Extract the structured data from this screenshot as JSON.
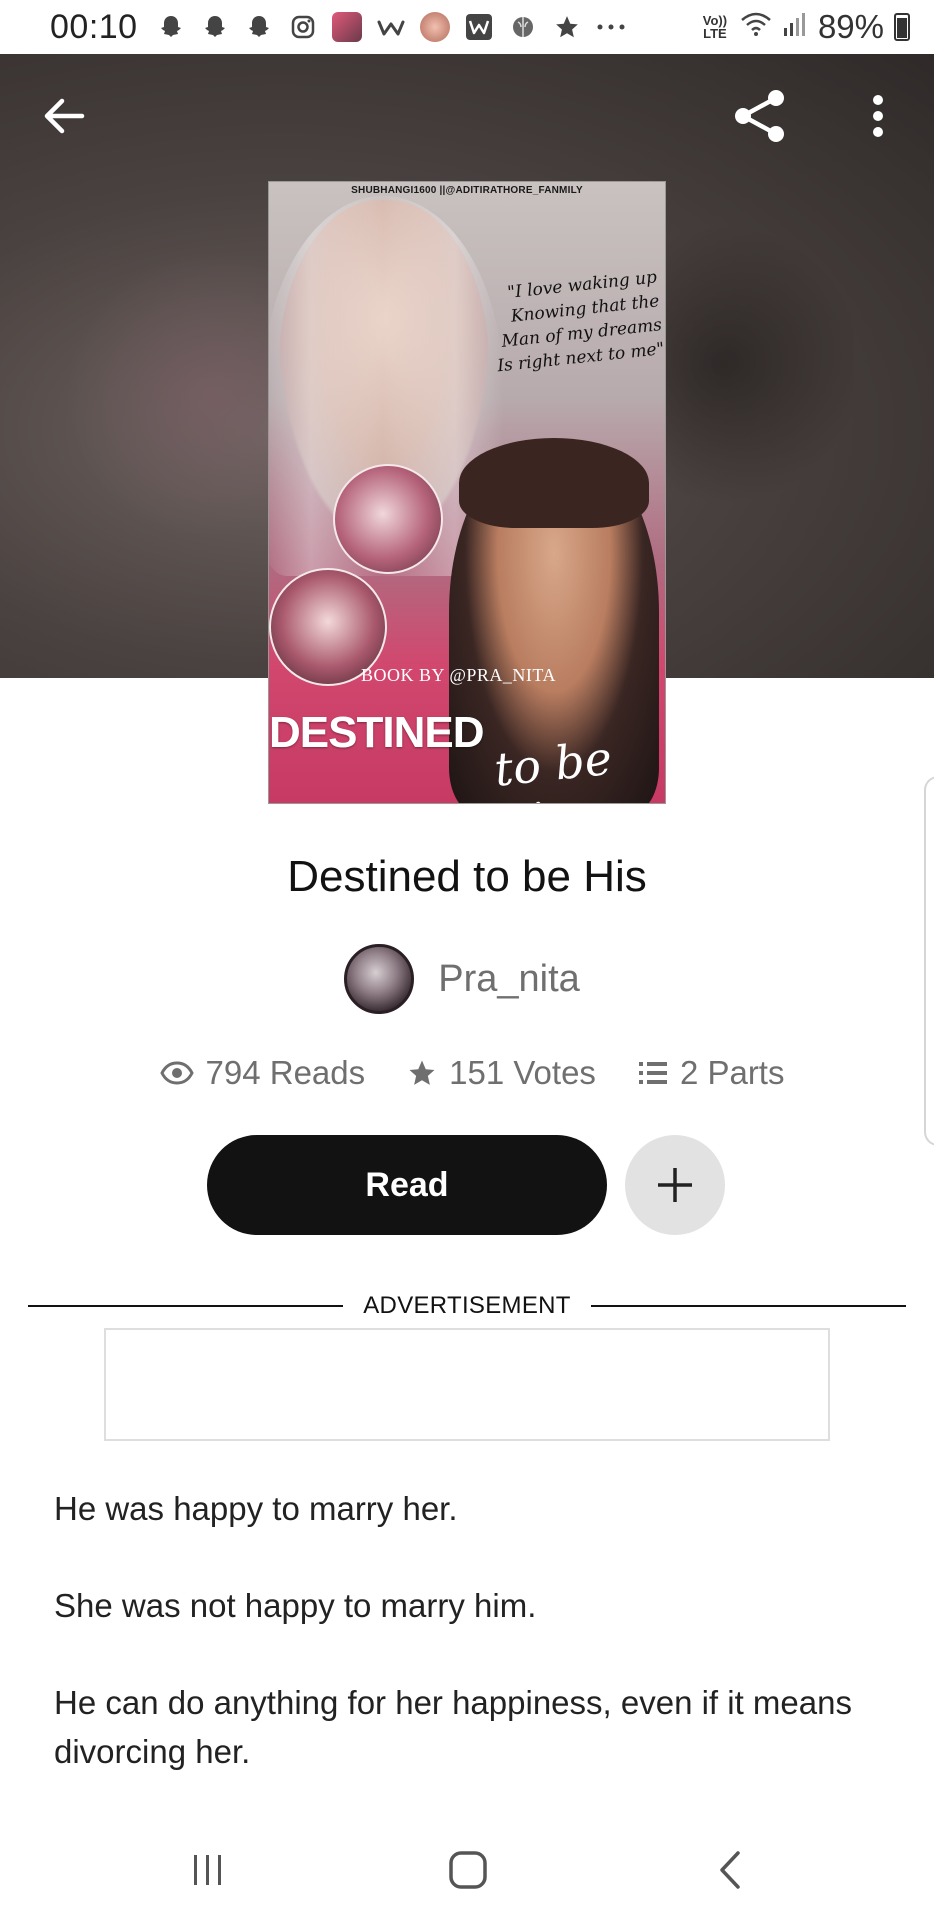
{
  "status_bar": {
    "time": "00:10",
    "battery": "89%",
    "icons": [
      "snapchat-icon",
      "snapchat-icon",
      "snapchat-icon",
      "instagram-icon",
      "app-icon",
      "wattpad-icon",
      "app-icon",
      "webtoon-icon",
      "brain-icon",
      "star-icon",
      "more-dots-icon",
      "volte-icon",
      "wifi-icon",
      "signal-icon",
      "battery-icon"
    ],
    "volte_label": "Vo)) LTE"
  },
  "header": {
    "back_icon": "arrow-left-icon",
    "share_icon": "share-icon",
    "more_icon": "more-vertical-icon"
  },
  "cover": {
    "credit": "SHUBHANGI1600 ||@ADITIRATHORE_FANMILY",
    "quote": "\"I love waking up Knowing that the Man of my dreams Is right next to me\"",
    "book_by": "BOOK BY @PRA_NITA",
    "title_big": "DESTINED",
    "title_script": "to be his"
  },
  "story": {
    "title": "Destined to be His",
    "author": "Pra_nita",
    "reads": "794 Reads",
    "votes": "151 Votes",
    "parts": "2 Parts"
  },
  "actions": {
    "read_label": "Read"
  },
  "ad": {
    "label": "ADVERTISEMENT"
  },
  "description": {
    "paragraphs": [
      "He was happy to marry her.",
      "She was not happy to marry him.",
      "He can do anything for her happiness, even if it means divorcing her."
    ]
  },
  "colors": {
    "primary_text": "#121212",
    "secondary_text": "#6f6f6f",
    "button_dark": "#121212",
    "button_light": "#e2e2e2"
  }
}
